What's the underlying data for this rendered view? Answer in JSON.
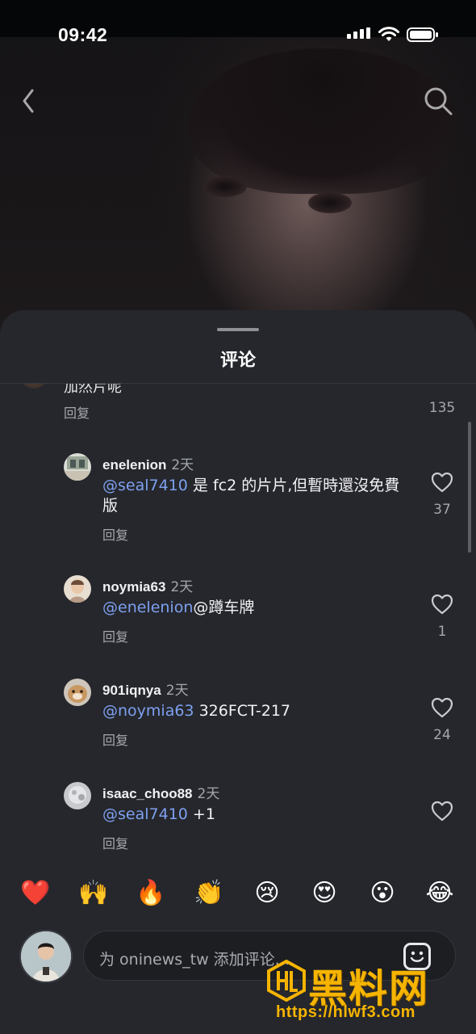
{
  "status_bar": {
    "time": "09:42"
  },
  "sheet": {
    "title": "评论"
  },
  "partial_comment": {
    "text": "加然片呢",
    "reply_label": "回复",
    "likes": "135"
  },
  "comments": [
    {
      "username": "enelenion",
      "age": "2天",
      "mention": "@seal7410",
      "text": " 是 fc2 的片片,但暫時還沒免費版",
      "reply_label": "回复",
      "likes": "37"
    },
    {
      "username": "noymia63",
      "age": "2天",
      "mention": "@enelenion",
      "text": "@蹲车牌",
      "reply_label": "回复",
      "likes": "1"
    },
    {
      "username": "901iqnya",
      "age": "2天",
      "mention": "@noymia63",
      "text": " 326FCT-217",
      "reply_label": "回复",
      "likes": "24"
    },
    {
      "username": "isaac_choo88",
      "age": "2天",
      "mention": "@seal7410",
      "text": " +1",
      "reply_label": "回复",
      "likes": ""
    }
  ],
  "emoji_bar": [
    "❤️",
    "🙌",
    "🔥",
    "👏",
    "😢",
    "😍",
    "😮",
    "😂"
  ],
  "composer": {
    "placeholder": "为 oninews_tw 添加评论..."
  },
  "watermark": {
    "title": "黑料网",
    "url": "https://hlwf3.com"
  },
  "colors": {
    "sheet": "#25272c",
    "mention": "#7ea0ef",
    "secondary_text": "#a4a7ad",
    "watermark": "#f6b400"
  },
  "icons": [
    "back-icon",
    "search-icon",
    "signal-icon",
    "wifi-icon",
    "battery-icon",
    "heart-icon",
    "sticker-icon"
  ]
}
